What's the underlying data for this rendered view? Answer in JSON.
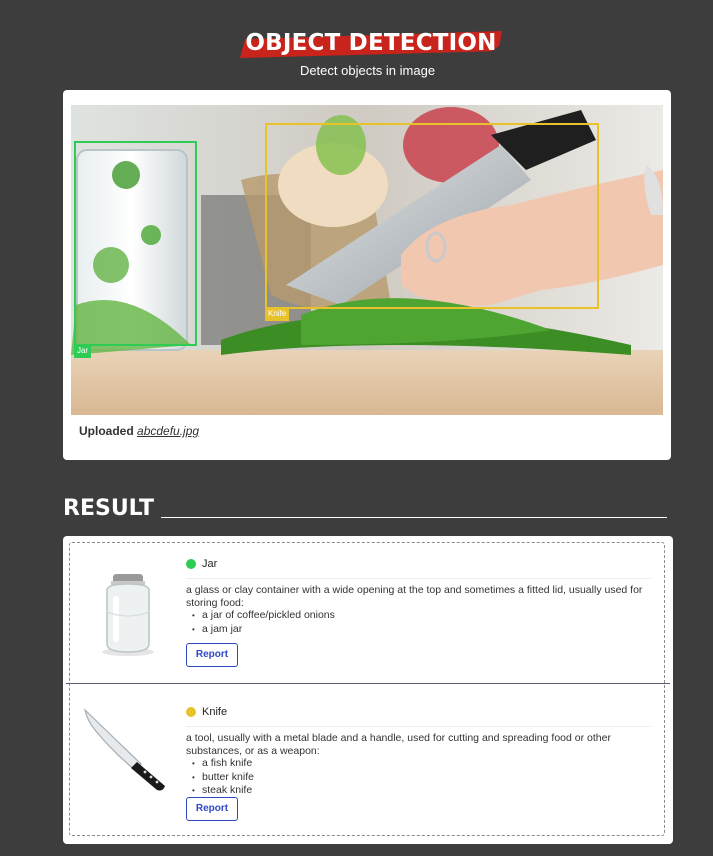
{
  "header": {
    "title": "OBJECT DETECTION",
    "subtitle": "Detect objects in image",
    "accent_color": "#c8241b"
  },
  "upload": {
    "uploaded_label": "Uploaded",
    "filename": "abcdefu.jpg",
    "detections": [
      {
        "label": "Jar",
        "color": "#2ecc55"
      },
      {
        "label": "Knife",
        "color": "#e8c22a"
      }
    ]
  },
  "result": {
    "title": "RESULT",
    "items": [
      {
        "name": "Jar",
        "color": "#2ecc55",
        "icon": "jar-image",
        "definition": "a glass or clay container with a wide opening at the top and sometimes a fitted lid, usually used for storing food:",
        "examples": [
          "a jar of coffee/pickled onions",
          "a jam jar"
        ],
        "report_label": "Report"
      },
      {
        "name": "Knife",
        "color": "#e8c22a",
        "icon": "knife-image",
        "definition": "a tool, usually with a metal blade and a handle, used for cutting and spreading food or other substances, or as a weapon:",
        "examples": [
          "a fish knife",
          "butter knife",
          "steak knife"
        ],
        "report_label": "Report"
      }
    ]
  }
}
